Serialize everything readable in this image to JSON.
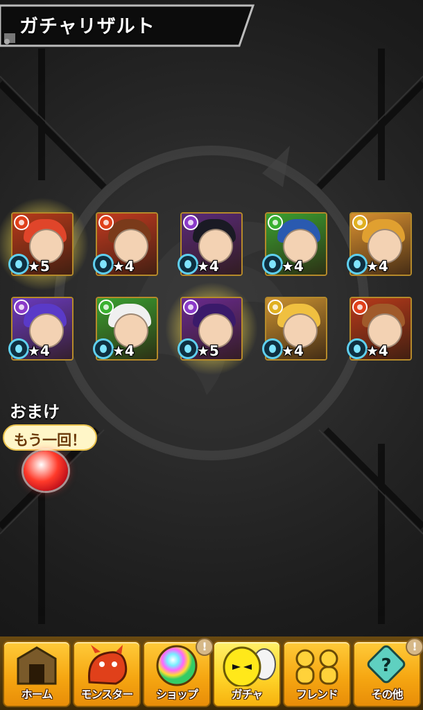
{
  "header": {
    "title": "ガチャリザルト"
  },
  "results": [
    {
      "rarity": "★5",
      "element": "fire",
      "glow": true,
      "hair_color": "#e0452a",
      "bg": "#b83a1a",
      "element_color": "#e0401a"
    },
    {
      "rarity": "★4",
      "element": "fire",
      "glow": false,
      "hair_color": "#7a3a1a",
      "bg": "#c23a20",
      "element_color": "#e0401a"
    },
    {
      "rarity": "★4",
      "element": "dark",
      "glow": false,
      "hair_color": "#1a1a24",
      "bg": "#5a2a7a",
      "element_color": "#8a3ac8"
    },
    {
      "rarity": "★4",
      "element": "wood",
      "glow": false,
      "hair_color": "#2a5ab0",
      "bg": "#3aa030",
      "element_color": "#3ab030"
    },
    {
      "rarity": "★4",
      "element": "light",
      "glow": false,
      "hair_color": "#e0a030",
      "bg": "#d89030",
      "element_color": "#e0b020"
    },
    {
      "rarity": "★4",
      "element": "dark",
      "glow": false,
      "hair_color": "#5a3ac8",
      "bg": "#6a3ac0",
      "element_color": "#8a3ac8"
    },
    {
      "rarity": "★4",
      "element": "wood",
      "glow": false,
      "hair_color": "#f0f0f0",
      "bg": "#3aa030",
      "element_color": "#3ab030"
    },
    {
      "rarity": "★5",
      "element": "dark",
      "glow": true,
      "hair_color": "#3a1a6a",
      "bg": "#6a2a90",
      "element_color": "#8a3ac8"
    },
    {
      "rarity": "★4",
      "element": "light",
      "glow": false,
      "hair_color": "#f0c040",
      "bg": "#c89030",
      "element_color": "#e0b020"
    },
    {
      "rarity": "★4",
      "element": "fire",
      "glow": false,
      "hair_color": "#a05a2a",
      "bg": "#b83a1a",
      "element_color": "#e0401a"
    }
  ],
  "bonus": {
    "label": "おまけ",
    "bubble_text": "もう一回！"
  },
  "nav": [
    {
      "id": "home",
      "label": "ホーム",
      "icon": "home-gate-icon",
      "alert": ""
    },
    {
      "id": "monster",
      "label": "モンスター",
      "icon": "dragon-icon",
      "alert": ""
    },
    {
      "id": "shop",
      "label": "ショップ",
      "icon": "orb-icon",
      "alert": "!"
    },
    {
      "id": "gacha",
      "label": "ガチャ",
      "icon": "egg-icon",
      "alert": ""
    },
    {
      "id": "friend",
      "label": "フレンド",
      "icon": "friends-icon",
      "alert": ""
    },
    {
      "id": "other",
      "label": "その他",
      "icon": "question-icon",
      "alert": "!"
    }
  ],
  "colors": {
    "accent_gold": "#f6a712",
    "rarity_badge_ring": "#5fd0f0"
  }
}
